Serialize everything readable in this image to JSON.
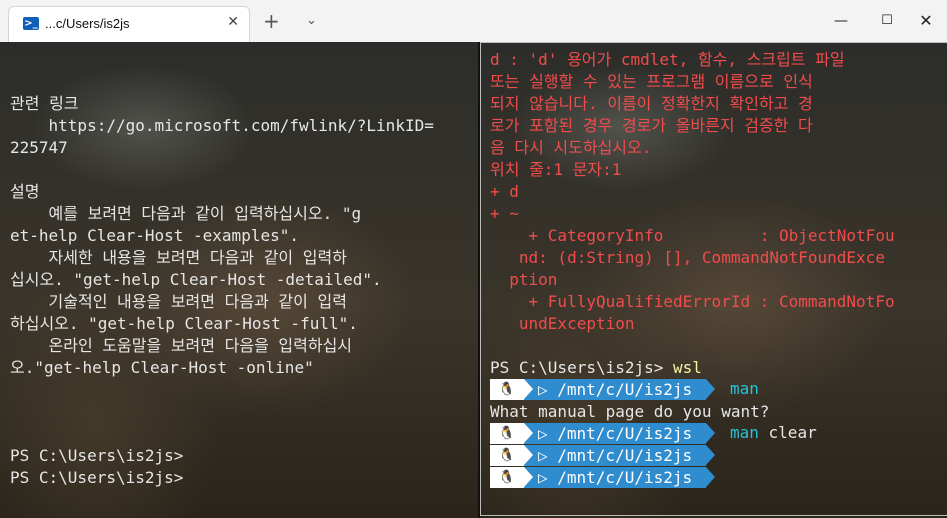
{
  "window": {
    "tab_title": "...c/Users/is2js",
    "tab_icon": "powershell-icon",
    "close_tab_glyph": "✕",
    "new_tab_glyph": "+",
    "dropdown_glyph": "⌄",
    "minimize_glyph": "—",
    "maximize_glyph": "☐",
    "close_glyph": "✕"
  },
  "left_pane": {
    "lines": [
      "관련 링크",
      "    https://go.microsoft.com/fwlink/?LinkID=",
      "225747",
      "",
      "설명",
      "    예를 보려면 다음과 같이 입력하십시오. \"g",
      "et-help Clear-Host -examples\".",
      "    자세한 내용을 보려면 다음과 같이 입력하",
      "십시오. \"get-help Clear-Host -detailed\".",
      "    기술적인 내용을 보려면 다음과 같이 입력",
      "하십시오. \"get-help Clear-Host -full\".",
      "    온라인 도움말을 보려면 다음을 입력하십시",
      "오.\"get-help Clear-Host -online\"",
      "",
      "",
      "",
      "PS C:\\Users\\is2js>",
      "PS C:\\Users\\is2js>"
    ]
  },
  "right_pane": {
    "error_lines": [
      "d : 'd' 용어가 cmdlet, 함수, 스크립트 파일",
      "또는 실행할 수 있는 프로그램 이름으로 인식",
      "되지 않습니다. 이름이 정확한지 확인하고 경",
      "로가 포함된 경우 경로가 올바른지 검증한 다",
      "음 다시 시도하십시오.",
      "위치 줄:1 문자:1",
      "+ d",
      "+ ~",
      "    + CategoryInfo          : ObjectNotFou",
      "   nd: (d:String) [], CommandNotFoundExce",
      "  ption",
      "    + FullyQualifiedErrorId : CommandNotFo",
      "   undException"
    ],
    "ps_prompt": "PS C:\\Users\\is2js>",
    "ps_command": "wsl",
    "wsl_prompts": [
      {
        "path_pre": "/mnt/c/",
        "path_u": "U",
        "path_post": "/is2js",
        "command": "man",
        "argument": ""
      },
      {
        "path_pre": "/mnt/c/",
        "path_u": "U",
        "path_post": "/is2js",
        "command": "man",
        "argument": " clear"
      },
      {
        "path_pre": "/mnt/c/",
        "path_u": "U",
        "path_post": "/is2js",
        "command": "",
        "argument": ""
      },
      {
        "path_pre": "/mnt/c/",
        "path_u": "U",
        "path_post": "/is2js",
        "command": "",
        "argument": ""
      }
    ],
    "man_question": "What manual page do you want?",
    "colors": {
      "error": "#f14c4c",
      "command": "#25c4d8",
      "segment_path_bg": "#2f8ccf",
      "segment_os_bg": "#ffffff"
    }
  }
}
